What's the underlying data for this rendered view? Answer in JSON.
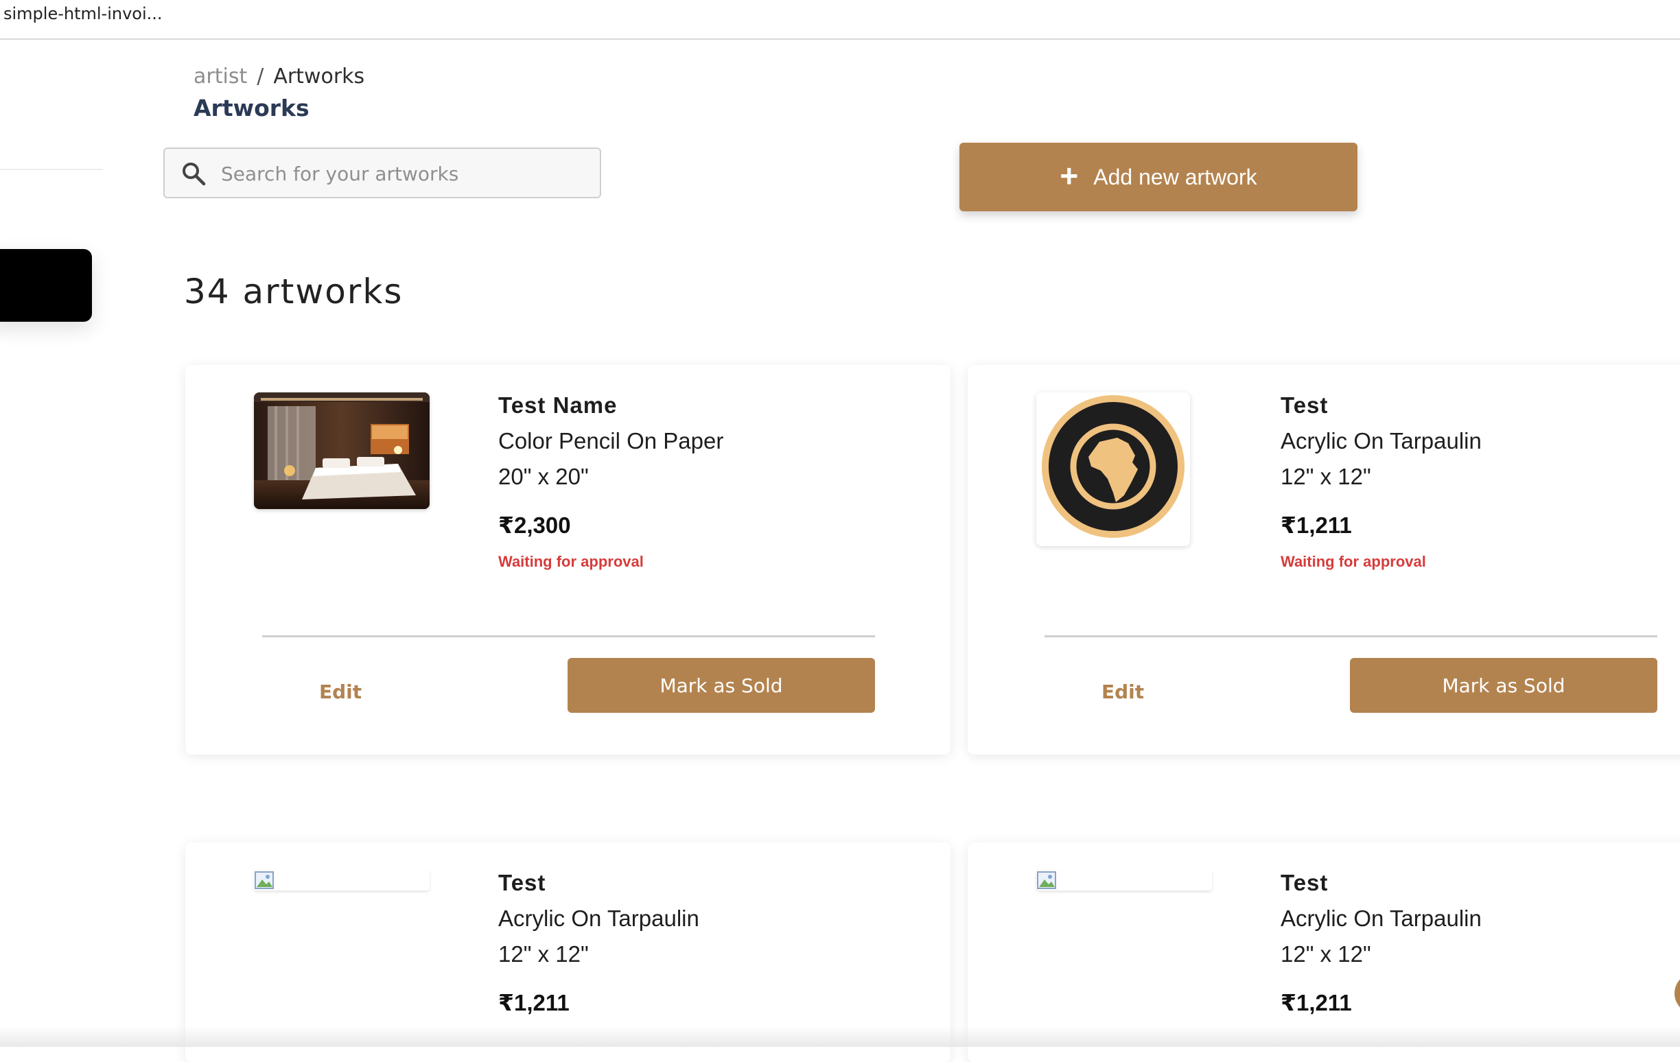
{
  "browser": {
    "tab_title": "simple-html-invoi..."
  },
  "breadcrumb": {
    "root": "artist",
    "separator": "/",
    "current": "Artworks"
  },
  "page_title": "Artworks",
  "search": {
    "placeholder": "Search for your artworks",
    "value": ""
  },
  "add_button": {
    "icon": "+",
    "label": "Add new artwork"
  },
  "artwork_count": "34 artworks",
  "colors": {
    "accent": "#b3834f",
    "status": "#d63c3c",
    "title": "#2b3a55"
  },
  "cards": [
    {
      "thumbnail": "bedroom-photo",
      "name": "Test Name",
      "medium": "Color Pencil On Paper",
      "size": "20\" x 20\"",
      "price": "₹2,300",
      "status": "Waiting for approval",
      "edit_label": "Edit",
      "sold_label": "Mark as Sold"
    },
    {
      "thumbnail": "globe-badge",
      "name": "Test",
      "medium": "Acrylic On Tarpaulin",
      "size": "12\" x 12\"",
      "price": "₹1,211",
      "status": "Waiting for approval",
      "edit_label": "Edit",
      "sold_label": "Mark as Sold"
    },
    {
      "thumbnail": "broken-image",
      "name": "Test",
      "medium": "Acrylic On Tarpaulin",
      "size": "12\" x 12\"",
      "price": "₹1,211"
    },
    {
      "thumbnail": "broken-image",
      "name": "Test",
      "medium": "Acrylic On Tarpaulin",
      "size": "12\" x 12\"",
      "price": "₹1,211"
    }
  ]
}
